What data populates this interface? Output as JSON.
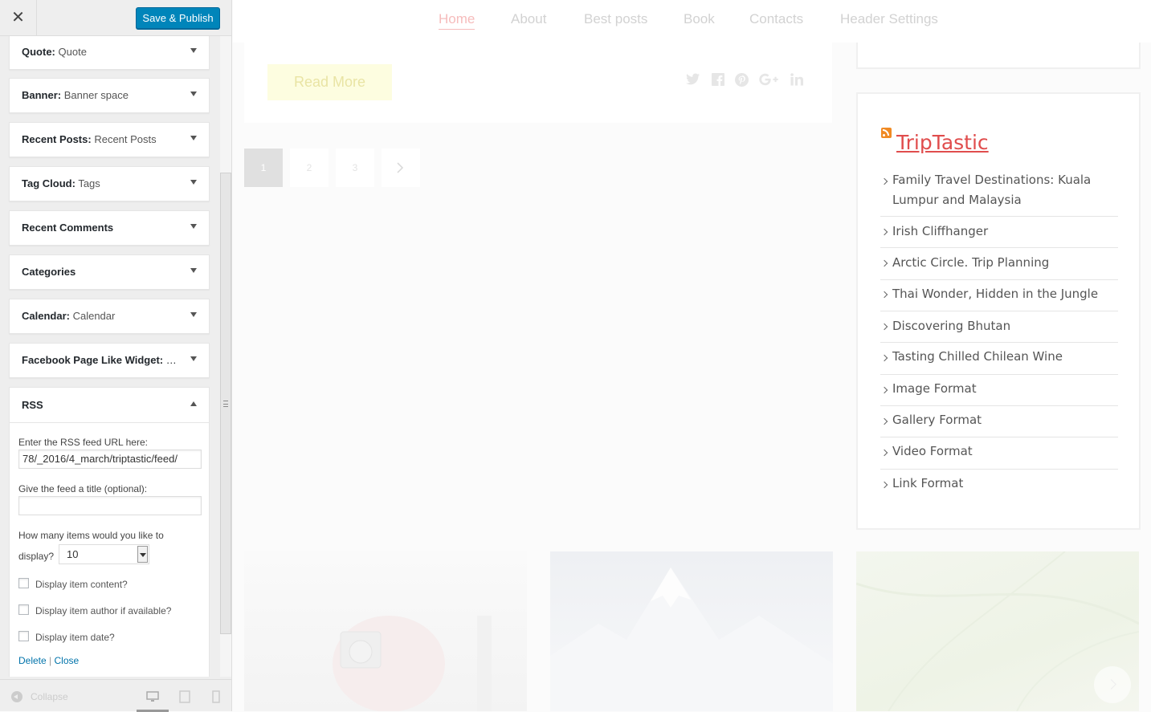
{
  "sidebar": {
    "close_label": "✕",
    "save_publish_label": "Save & Publish",
    "widgets": [
      {
        "name": "Quote:",
        "title": "Quote"
      },
      {
        "name": "Banner:",
        "title": "Banner space"
      },
      {
        "name": "Recent Posts:",
        "title": "Recent Posts"
      },
      {
        "name": "Tag Cloud:",
        "title": "Tags"
      },
      {
        "name": "Recent Comments",
        "title": ""
      },
      {
        "name": "Categories",
        "title": ""
      },
      {
        "name": "Calendar:",
        "title": "Calendar"
      },
      {
        "name": "Facebook Page Like Widget:",
        "title": "F..."
      }
    ],
    "rss": {
      "heading": "RSS",
      "url_label": "Enter the RSS feed URL here:",
      "url_value": "78/_2016/4_march/triptastic/feed/",
      "title_label": "Give the feed a title (optional):",
      "title_value": "",
      "items_label_1": "How many items would you like to",
      "items_label_2": "display?",
      "items_value": "10",
      "check_content": "Display item content?",
      "check_author": "Display item author if available?",
      "check_date": "Display item date?",
      "delete_label": "Delete",
      "separator": "|",
      "close_label": "Close"
    },
    "footer": {
      "collapse_label": "Collapse"
    }
  },
  "preview": {
    "nav": [
      "Home",
      "About",
      "Best posts",
      "Book",
      "Contacts",
      "Header Settings"
    ],
    "read_more": "Read More",
    "share_icons": [
      "twitter-icon",
      "facebook-icon",
      "pinterest-icon",
      "google-plus-icon",
      "linkedin-icon"
    ],
    "pagination": [
      "1",
      "2",
      "3"
    ],
    "rss_widget": {
      "title": "TripTastic",
      "items": [
        "Family Travel Destinations: Kuala Lumpur and Malaysia",
        "Irish Cliffhanger",
        "Arctic Circle. Trip Planning",
        "Thai Wonder, Hidden in the Jungle",
        "Discovering Bhutan",
        "Tasting Chilled Chilean Wine",
        "Image Format",
        "Gallery Format",
        "Video Format",
        "Link Format"
      ]
    }
  },
  "colors": {
    "primary_button": "#0085ba",
    "rss_title": "#e04d4d",
    "link": "#0073aa"
  }
}
